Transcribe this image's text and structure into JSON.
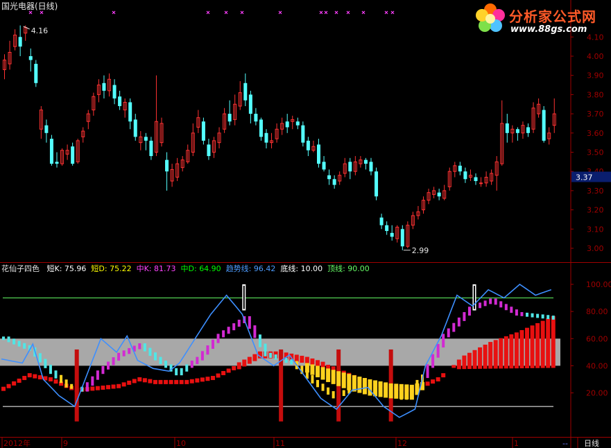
{
  "window": {
    "title": "国光电器(日线)"
  },
  "logo": {
    "name": "分析家公式网",
    "url": "www.88gs.com"
  },
  "price_panel": {
    "y_ticks": [
      "4.10",
      "4.00",
      "3.90",
      "3.80",
      "3.70",
      "3.60",
      "3.50",
      "3.40",
      "3.30",
      "3.20",
      "3.10",
      "3.00"
    ],
    "y_values": [
      4.1,
      4.0,
      3.9,
      3.8,
      3.7,
      3.6,
      3.5,
      3.4,
      3.3,
      3.2,
      3.1,
      3.0
    ],
    "current_price": "3.37",
    "high_label": "4.16",
    "low_label": "2.99"
  },
  "indicator_panel": {
    "name": "花仙子四色",
    "items": [
      {
        "label": "短K:",
        "value": "75.96",
        "color": "#ffffff"
      },
      {
        "label": "短D:",
        "value": "75.22",
        "color": "#ffff00"
      },
      {
        "label": "中K:",
        "value": "81.73",
        "color": "#ff44ff"
      },
      {
        "label": "中D:",
        "value": "64.90",
        "color": "#00ff00"
      },
      {
        "label": "趋势线:",
        "value": "96.42",
        "color": "#4d9cff"
      },
      {
        "label": "底线:",
        "value": "10.00",
        "color": "#ffffff"
      },
      {
        "label": "顶线:",
        "value": "90.00",
        "color": "#66ff66"
      }
    ],
    "y_ticks": [
      "100.00",
      "80.00",
      "60.00",
      "40.00",
      "20.00"
    ],
    "y_values": [
      100,
      80,
      60,
      40,
      20
    ]
  },
  "x_axis": {
    "labels": [
      "2012年",
      "9",
      "10",
      "11",
      "12",
      "1"
    ],
    "period": "日线",
    "scroll_marker": "--"
  },
  "colors": {
    "up": "#ff3232",
    "down": "#54ffff",
    "grid_red": "#a00000",
    "trend": "#3d8fff",
    "magenta": "#d22ad2",
    "yellow": "#ffd21e",
    "cyan": "#50e6e6",
    "red_bar": "#e81010",
    "band": "#a8a8a8"
  },
  "chart_data": {
    "type": "candlestick",
    "series": [
      {
        "name": "price",
        "values": [
          [
            3.93,
            3.98,
            4.01,
            3.88
          ],
          [
            3.96,
            4.02,
            4.08,
            3.93
          ],
          [
            4.05,
            4.11,
            4.14,
            4.03
          ],
          [
            4.1,
            4.05,
            4.16,
            4.0
          ],
          [
            4.12,
            4.15,
            4.16,
            4.08
          ],
          [
            4.0,
            3.98,
            4.04,
            3.92
          ],
          [
            3.96,
            3.86,
            3.98,
            3.84
          ],
          [
            3.62,
            3.72,
            3.74,
            3.57
          ],
          [
            3.64,
            3.6,
            3.67,
            3.55
          ],
          [
            3.57,
            3.44,
            3.59,
            3.43
          ],
          [
            3.45,
            3.44,
            3.5,
            3.42
          ],
          [
            3.44,
            3.51,
            3.52,
            3.43
          ],
          [
            3.49,
            3.51,
            3.54,
            3.46
          ],
          [
            3.53,
            3.44,
            3.55,
            3.43
          ],
          [
            3.45,
            3.56,
            3.57,
            3.44
          ],
          [
            3.58,
            3.61,
            3.63,
            3.55
          ],
          [
            3.66,
            3.7,
            3.72,
            3.62
          ],
          [
            3.72,
            3.79,
            3.81,
            3.69
          ],
          [
            3.8,
            3.85,
            3.88,
            3.76
          ],
          [
            3.86,
            3.82,
            3.9,
            3.78
          ],
          [
            3.82,
            3.88,
            3.91,
            3.79
          ],
          [
            3.85,
            3.78,
            3.88,
            3.75
          ],
          [
            3.79,
            3.74,
            3.82,
            3.72
          ],
          [
            3.72,
            3.76,
            3.78,
            3.68
          ],
          [
            3.76,
            3.66,
            3.78,
            3.62
          ],
          [
            3.67,
            3.58,
            3.7,
            3.56
          ],
          [
            3.55,
            3.58,
            3.61,
            3.51
          ],
          [
            3.58,
            3.56,
            3.6,
            3.51
          ],
          [
            3.56,
            3.48,
            3.58,
            3.46
          ],
          [
            3.5,
            3.66,
            3.9,
            3.48
          ],
          [
            3.55,
            3.65,
            3.68,
            3.53
          ],
          [
            3.46,
            3.4,
            3.5,
            3.3
          ],
          [
            3.35,
            3.41,
            3.44,
            3.32
          ],
          [
            3.37,
            3.44,
            3.47,
            3.35
          ],
          [
            3.42,
            3.46,
            3.48,
            3.4
          ],
          [
            3.45,
            3.51,
            3.54,
            3.44
          ],
          [
            3.5,
            3.6,
            3.65,
            3.48
          ],
          [
            3.63,
            3.68,
            3.72,
            3.6
          ],
          [
            3.66,
            3.56,
            3.68,
            3.54
          ],
          [
            3.54,
            3.48,
            3.57,
            3.46
          ],
          [
            3.5,
            3.56,
            3.58,
            3.47
          ],
          [
            3.55,
            3.6,
            3.63,
            3.52
          ],
          [
            3.62,
            3.7,
            3.73,
            3.6
          ],
          [
            3.7,
            3.66,
            3.77,
            3.64
          ],
          [
            3.67,
            3.75,
            3.8,
            3.64
          ],
          [
            3.74,
            3.81,
            3.87,
            3.72
          ],
          [
            3.86,
            3.77,
            3.91,
            3.74
          ],
          [
            3.8,
            3.7,
            3.82,
            3.65
          ],
          [
            3.7,
            3.66,
            3.73,
            3.64
          ],
          [
            3.67,
            3.58,
            3.68,
            3.56
          ],
          [
            3.6,
            3.55,
            3.62,
            3.52
          ],
          [
            3.55,
            3.56,
            3.6,
            3.52
          ],
          [
            3.57,
            3.62,
            3.65,
            3.55
          ],
          [
            3.62,
            3.65,
            3.68,
            3.59
          ],
          [
            3.66,
            3.63,
            3.7,
            3.6
          ],
          [
            3.66,
            3.67,
            3.69,
            3.62
          ],
          [
            3.66,
            3.64,
            3.68,
            3.62
          ],
          [
            3.64,
            3.55,
            3.66,
            3.53
          ],
          [
            3.56,
            3.51,
            3.58,
            3.48
          ],
          [
            3.51,
            3.53,
            3.56,
            3.5
          ],
          [
            3.54,
            3.44,
            3.57,
            3.42
          ],
          [
            3.45,
            3.41,
            3.48,
            3.4
          ],
          [
            3.38,
            3.36,
            3.41,
            3.33
          ],
          [
            3.36,
            3.33,
            3.38,
            3.31
          ],
          [
            3.35,
            3.38,
            3.4,
            3.33
          ],
          [
            3.39,
            3.44,
            3.47,
            3.37
          ],
          [
            3.45,
            3.4,
            3.47,
            3.36
          ],
          [
            3.4,
            3.45,
            3.48,
            3.38
          ],
          [
            3.44,
            3.46,
            3.48,
            3.42
          ],
          [
            3.46,
            3.44,
            3.47,
            3.41
          ],
          [
            3.45,
            3.4,
            3.47,
            3.38
          ],
          [
            3.4,
            3.27,
            3.42,
            3.25
          ],
          [
            3.16,
            3.12,
            3.18,
            3.1
          ],
          [
            3.12,
            3.09,
            3.14,
            3.07
          ],
          [
            3.08,
            3.06,
            3.12,
            3.04
          ],
          [
            3.05,
            3.11,
            3.12,
            3.03
          ],
          [
            3.1,
            3.01,
            3.12,
            2.99
          ],
          [
            3.01,
            3.12,
            3.14,
            3.0
          ],
          [
            3.12,
            3.17,
            3.19,
            3.1
          ],
          [
            3.17,
            3.19,
            3.22,
            3.15
          ],
          [
            3.2,
            3.25,
            3.27,
            3.18
          ],
          [
            3.25,
            3.29,
            3.31,
            3.23
          ],
          [
            3.28,
            3.3,
            3.32,
            3.26
          ],
          [
            3.29,
            3.27,
            3.31,
            3.25
          ],
          [
            3.26,
            3.3,
            3.33,
            3.25
          ],
          [
            3.32,
            3.4,
            3.42,
            3.3
          ],
          [
            3.4,
            3.43,
            3.45,
            3.37
          ],
          [
            3.43,
            3.4,
            3.45,
            3.38
          ],
          [
            3.4,
            3.36,
            3.42,
            3.34
          ],
          [
            3.37,
            3.38,
            3.41,
            3.35
          ],
          [
            3.37,
            3.35,
            3.39,
            3.33
          ],
          [
            3.34,
            3.34,
            3.37,
            3.32
          ],
          [
            3.34,
            3.37,
            3.4,
            3.32
          ],
          [
            3.35,
            3.39,
            3.41,
            3.33
          ],
          [
            3.38,
            3.45,
            3.48,
            3.3
          ],
          [
            3.44,
            3.65,
            3.77,
            3.43
          ],
          [
            3.65,
            3.6,
            3.7,
            3.55
          ],
          [
            3.6,
            3.62,
            3.64,
            3.55
          ],
          [
            3.62,
            3.6,
            3.63,
            3.56
          ],
          [
            3.6,
            3.64,
            3.66,
            3.57
          ],
          [
            3.63,
            3.6,
            3.65,
            3.58
          ],
          [
            3.62,
            3.73,
            3.76,
            3.6
          ],
          [
            3.7,
            3.75,
            3.78,
            3.68
          ],
          [
            3.72,
            3.56,
            3.74,
            3.55
          ],
          [
            3.57,
            3.6,
            3.63,
            3.54
          ],
          [
            3.64,
            3.7,
            3.78,
            3.6
          ]
        ]
      }
    ]
  }
}
